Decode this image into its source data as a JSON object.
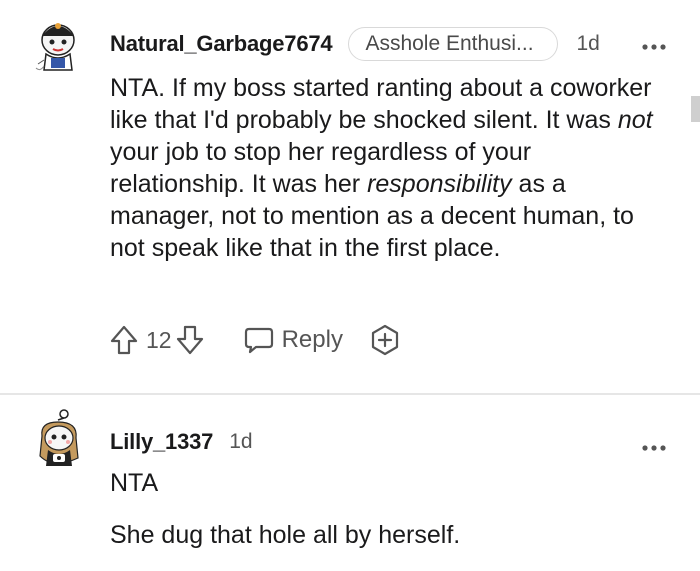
{
  "comments": [
    {
      "username": "Natural_Garbage7674",
      "flair": "Asshole Enthusi...",
      "time": "1d",
      "more_icon": "more-horizontal-icon",
      "body_parts": [
        "NTA. If my boss started ranting about a coworker like that I'd probably be shocked silent. It was ",
        "not",
        " your job to stop her regardless of your relationship. It was her ",
        "responsibility",
        " as a manager, not to mention as a decent human, to not speak like that in the first place."
      ],
      "vote_count": "12",
      "reply_label": "Reply",
      "icons": {
        "upvote": "upvote-arrow-icon",
        "downvote": "downvote-arrow-icon",
        "reply": "speech-bubble-icon",
        "award": "award-plus-icon"
      }
    },
    {
      "username": "Lilly_1337",
      "time": "1d",
      "more_icon": "more-horizontal-icon",
      "paragraphs": [
        "NTA",
        "She dug that hole all by herself."
      ]
    }
  ],
  "colors": {
    "text": "#1a1a1b",
    "muted": "#555555",
    "flair_border": "#d9d9d9",
    "divider": "#e6e6e6"
  }
}
